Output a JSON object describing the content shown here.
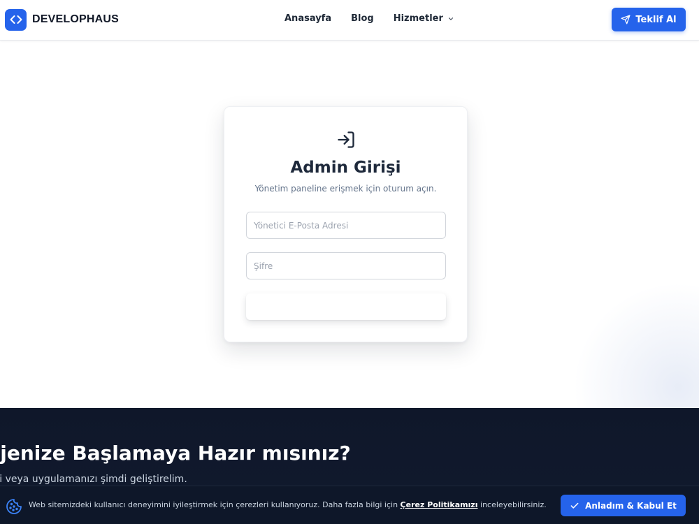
{
  "header": {
    "brand_name": "DEVELOPHAUS",
    "nav": [
      {
        "label": "Anasayfa"
      },
      {
        "label": "Blog"
      },
      {
        "label": "Hizmetler"
      }
    ],
    "cta_label": "Teklif Al"
  },
  "login": {
    "title": "Admin Girişi",
    "subtitle": "Yönetim paneline erişmek için oturum açın.",
    "email_placeholder": "Yönetici E-Posta Adresi",
    "email_value": "",
    "password_placeholder": "Şifre",
    "password_value": "",
    "submit_label": ""
  },
  "cta_section": {
    "title": "ojenize Başlamaya Hazır mısınız?",
    "subtitle": "izi veya uygulamanızı şimdi geliştirelim."
  },
  "cookie": {
    "text_before": "Web sitemizdeki kullanıcı deneyimini iyileştirmek için çerezleri kullanıyoruz. Daha fazla bilgi için ",
    "link_label": "Çerez Politikamızı",
    "text_after": " inceleyebilirsiniz.",
    "accept_label": "Anladım & Kabul Et"
  },
  "icons": {
    "brand": "code-icon",
    "cta": "send-icon",
    "dropdown": "chevron-down-icon",
    "login": "login-icon",
    "cookie": "cookie-icon",
    "accept": "check-icon"
  },
  "colors": {
    "accent": "#2563eb",
    "dark_section": "#0f172a",
    "text_primary": "#1e293b",
    "text_muted": "#64748b"
  }
}
